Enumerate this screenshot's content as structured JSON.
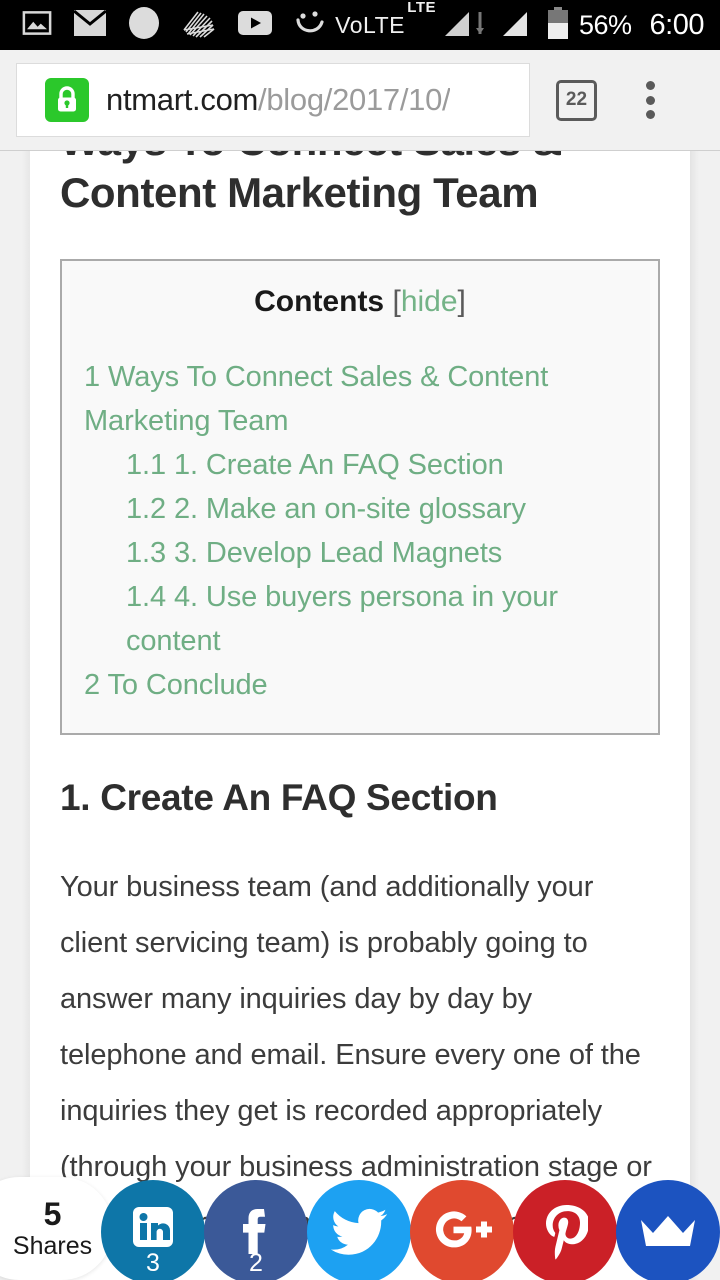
{
  "status_bar": {
    "notification_icons": [
      "image-icon",
      "email-icon",
      "circle-icon",
      "signature-icon",
      "youtube-icon",
      "smiley-icon"
    ],
    "network_label": "VoLTE",
    "network_sup": "LTE",
    "battery_percent": "56%",
    "time": "6:00"
  },
  "browser": {
    "url_host": "ntmart.com",
    "url_path": "/blog/2017/10/",
    "lock_icon": "lock-icon",
    "tab_count": "22",
    "menu_icon": "overflow-menu-icon"
  },
  "article": {
    "post_title": "Ways To Connect Sales & Content Marketing Team",
    "toc": {
      "title": "Contents",
      "bracket_open": "[",
      "hide_label": "hide",
      "bracket_close": "]",
      "items": [
        {
          "num": "1",
          "label": "Ways To Connect Sales & Content Marketing Team",
          "level": 1
        },
        {
          "num": "1.1",
          "label": "1. Create An FAQ Section",
          "level": 2
        },
        {
          "num": "1.2",
          "label": "2. Make an on-site glossary",
          "level": 2
        },
        {
          "num": "1.3",
          "label": "3. Develop Lead Magnets",
          "level": 2
        },
        {
          "num": "1.4",
          "label": "4. Use buyers persona in your content",
          "level": 2
        },
        {
          "num": "2",
          "label": "To Conclude",
          "level": 1
        }
      ]
    },
    "section_heading": "1. Create An FAQ Section",
    "body_paragraph": "Your business team (and additionally your client servicing team) is probably going to answer many inquiries day by day by telephone and email. Ensure every one of the inquiries they get is recorded appropriately (through your business administration stage or other apparatus) and given to your content"
  },
  "share_bar": {
    "total_count": "5",
    "total_label": "Shares",
    "buttons": [
      {
        "network": "linkedin",
        "icon": "linkedin-icon",
        "count": "3",
        "color": "#0e76a8"
      },
      {
        "network": "facebook",
        "icon": "facebook-icon",
        "count": "2",
        "color": "#3b5998"
      },
      {
        "network": "twitter",
        "icon": "twitter-icon",
        "count": "",
        "color": "#1da1f2"
      },
      {
        "network": "googleplus",
        "icon": "google-plus-icon",
        "count": "",
        "color": "#e0492f"
      },
      {
        "network": "pinterest",
        "icon": "pinterest-icon",
        "count": "",
        "color": "#cb2027"
      },
      {
        "network": "sumo",
        "icon": "crown-icon",
        "count": "",
        "color": "#1c53c0"
      }
    ]
  },
  "colors": {
    "accent_green": "#6fae84",
    "status_bar_bg": "#000000",
    "toolbar_bg": "#f1f1f1",
    "lock_green": "#2bc82b"
  }
}
